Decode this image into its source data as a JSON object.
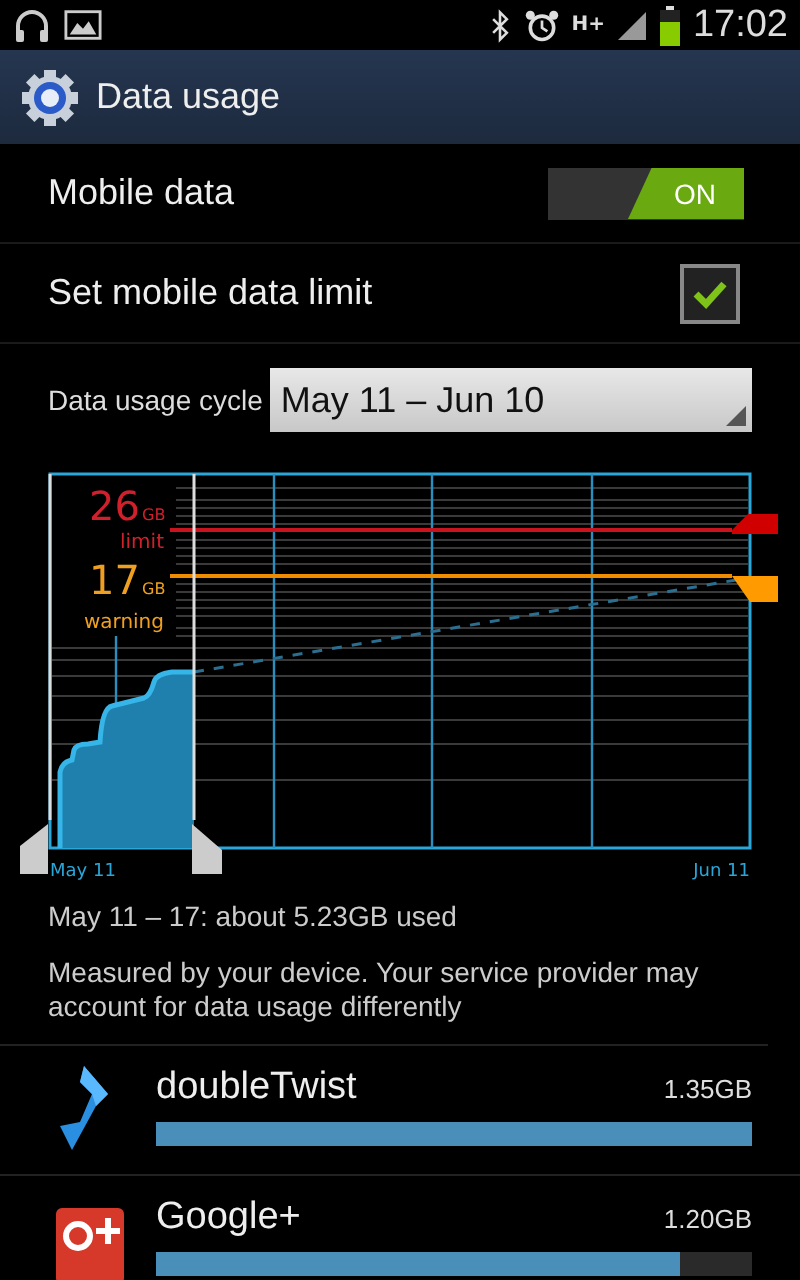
{
  "status_bar": {
    "network": "H+",
    "time": "17:02"
  },
  "action_bar": {
    "title": "Data usage"
  },
  "settings": [
    {
      "kind": "toggle",
      "label": "Mobile data",
      "on": true,
      "on_text": "ON"
    },
    {
      "kind": "checkbox",
      "label": "Set mobile data limit",
      "checked": true
    }
  ],
  "cycle": {
    "label": "Data usage cycle",
    "value": "May 11 – Jun 10"
  },
  "chart": {
    "limit_value": "26",
    "limit_unit": "GB",
    "limit_label": "limit",
    "warning_value": "17",
    "warning_unit": "GB",
    "warning_label": "warning",
    "start_label": "May 11",
    "end_label": "Jun 11"
  },
  "summary": "May 11 – 17: about 5.23GB used",
  "note": "Measured by your device. Your service provider may account for data usage differently",
  "apps": [
    {
      "kind": "twist",
      "name": "doubleTwist",
      "usage": "1.35GB",
      "level": 1
    },
    {
      "kind": "gplus",
      "name": "Google+",
      "usage": "1.20GB",
      "level": 0.88
    }
  ]
}
